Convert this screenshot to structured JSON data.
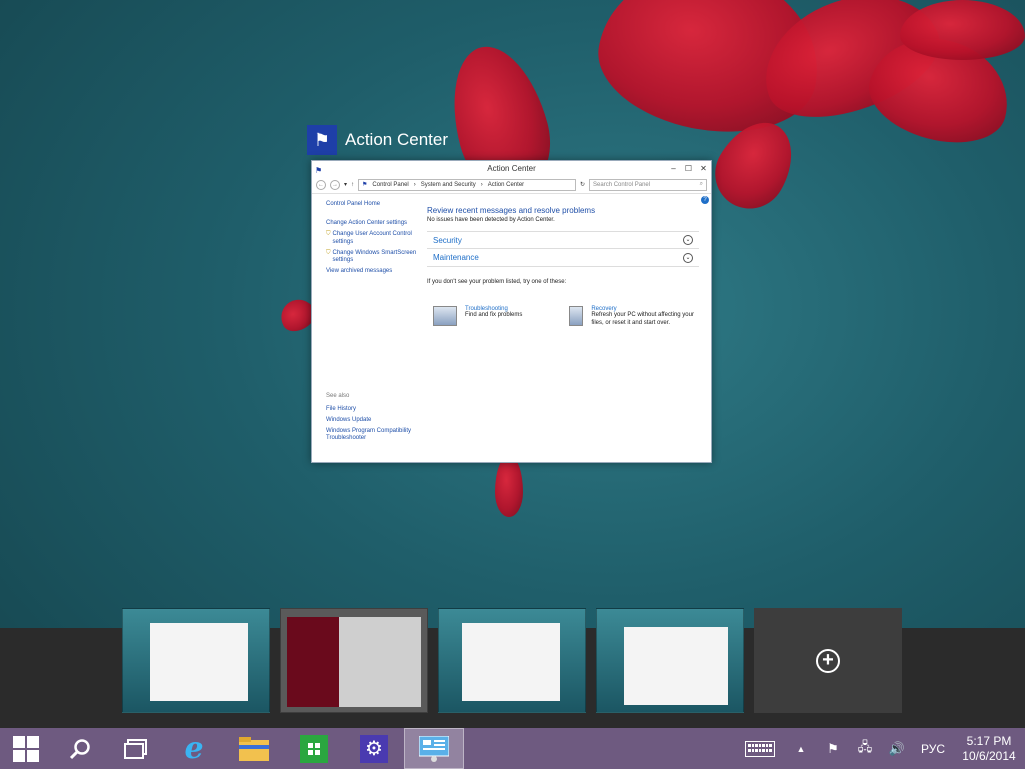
{
  "window_preview": {
    "caption": "Action Center",
    "title": "Action Center",
    "address": {
      "crumbs": [
        "Control Panel",
        "System and Security",
        "Action Center"
      ],
      "search_placeholder": "Search Control Panel"
    },
    "sidebar": {
      "home": "Control Panel Home",
      "links": [
        "Change Action Center settings",
        "Change User Account Control settings",
        "Change Windows SmartScreen settings",
        "View archived messages"
      ],
      "see_also_label": "See also",
      "see_also": [
        "File History",
        "Windows Update",
        "Windows Program Compatibility Troubleshooter"
      ]
    },
    "main": {
      "heading": "Review recent messages and resolve problems",
      "status": "No issues have been detected by Action Center.",
      "sections": [
        "Security",
        "Maintenance"
      ],
      "tip": "If you don't see your problem listed, try one of these:",
      "troubleshooting": {
        "label": "Troubleshooting",
        "desc": "Find and fix problems"
      },
      "recovery": {
        "label": "Recovery",
        "desc": "Refresh your PC without affecting your files, or reset it and start over."
      }
    }
  },
  "taskbar": {
    "language": "РУС",
    "time": "5:17 PM",
    "date": "10/6/2014"
  },
  "colors": {
    "taskbar": "#6e5a80",
    "accent_link": "#1f4fa8",
    "task_strip": "#2b2b2b"
  },
  "icons": {
    "start": "windows-logo-icon",
    "search": "search-icon",
    "task_view": "task-view-icon",
    "ie": "internet-explorer-icon",
    "explorer": "file-explorer-icon",
    "store": "store-icon",
    "settings": "settings-gear-icon",
    "control_panel": "control-panel-icon"
  }
}
